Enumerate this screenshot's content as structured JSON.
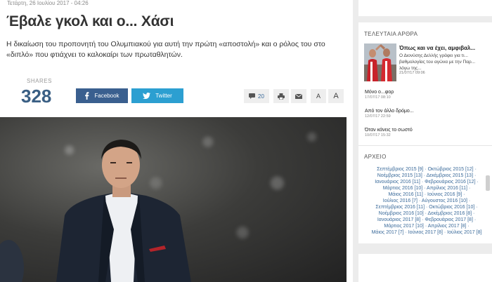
{
  "article": {
    "date": "Τετάρτη, 26 Ιουλίου 2017 - 04:26",
    "title": "Έβαλε γκολ και ο... Χάσι",
    "lede": "Η δικαίωση του προπονητή του Ολυμπιακού για αυτή την πρώτη «αποστολή» και ο ρόλος του στο «διπλό» που φτιάχνει το καλοκαίρι των πρωταθλητών.",
    "shares_label": "SHARES",
    "shares_count": "328",
    "facebook_label": "Facebook",
    "twitter_label": "Twitter",
    "comments_count": "20",
    "font_small_label": "A",
    "font_large_label": "A"
  },
  "sidebar": {
    "latest_title": "ΤΕΛΕΥΤΑΙΑ ΑΡΘΡΑ",
    "featured": {
      "title": "Όπως και να έχει, αμφιβαλ...",
      "text_line1": "Ο Διονύσης Δελλής γράφει για τι...",
      "text_line2": "βαθμολογίας του αγώνα με την Παρ...",
      "text_line3": "λόγω της...",
      "date": "21/07/17 09:06"
    },
    "articles": [
      {
        "title": "Μόνο ο...φορ",
        "date": "17/07/17 08:10"
      },
      {
        "title": "Από τον άλλο δρόμο...",
        "date": "12/07/17 22:59"
      },
      {
        "title": "Όταν κάνεις το σωστό",
        "date": "10/07/17 15:32"
      }
    ],
    "archive_title": "ΑΡΧΕΙΟ",
    "archive_lines": [
      "Σεπτέμβριος 2015 [9] · Οκτώβριος 2015 [12] ·",
      "Νοέμβριος 2015 [13] · Δεκέμβριος 2015 [13] ·",
      "Ιανουάριος 2016 [11] · Φεβρουάριος 2016 [12] ·",
      "Μάρτιος 2016 [10] · Απρίλιος 2016 [11] ·",
      "Μάιος 2016 [11] · Ιούνιος 2016 [9] ·",
      "Ιούλιος 2016 [7] · Αύγουστος 2016 [10] ·",
      "Σεπτέμβριος 2016 [11] · Οκτώβριος 2016 [10] ·",
      "Νοέμβριος 2016 [10] · Δεκέμβριος 2016 [8] ·",
      "Ιανουάριος 2017 [8] · Φεβρουάριος 2017 [8] ·",
      "Μάρτιος 2017 [10] · Απρίλιος 2017 [8] ·",
      "Μάιος 2017 [7] · Ιούνιος 2017 [8] · Ιούλιος 2017 [8]"
    ]
  },
  "colors": {
    "facebook": "#3a5f8f",
    "twitter": "#2c9fd1",
    "shares": "#3a5f84",
    "link": "#3a6a9a"
  }
}
